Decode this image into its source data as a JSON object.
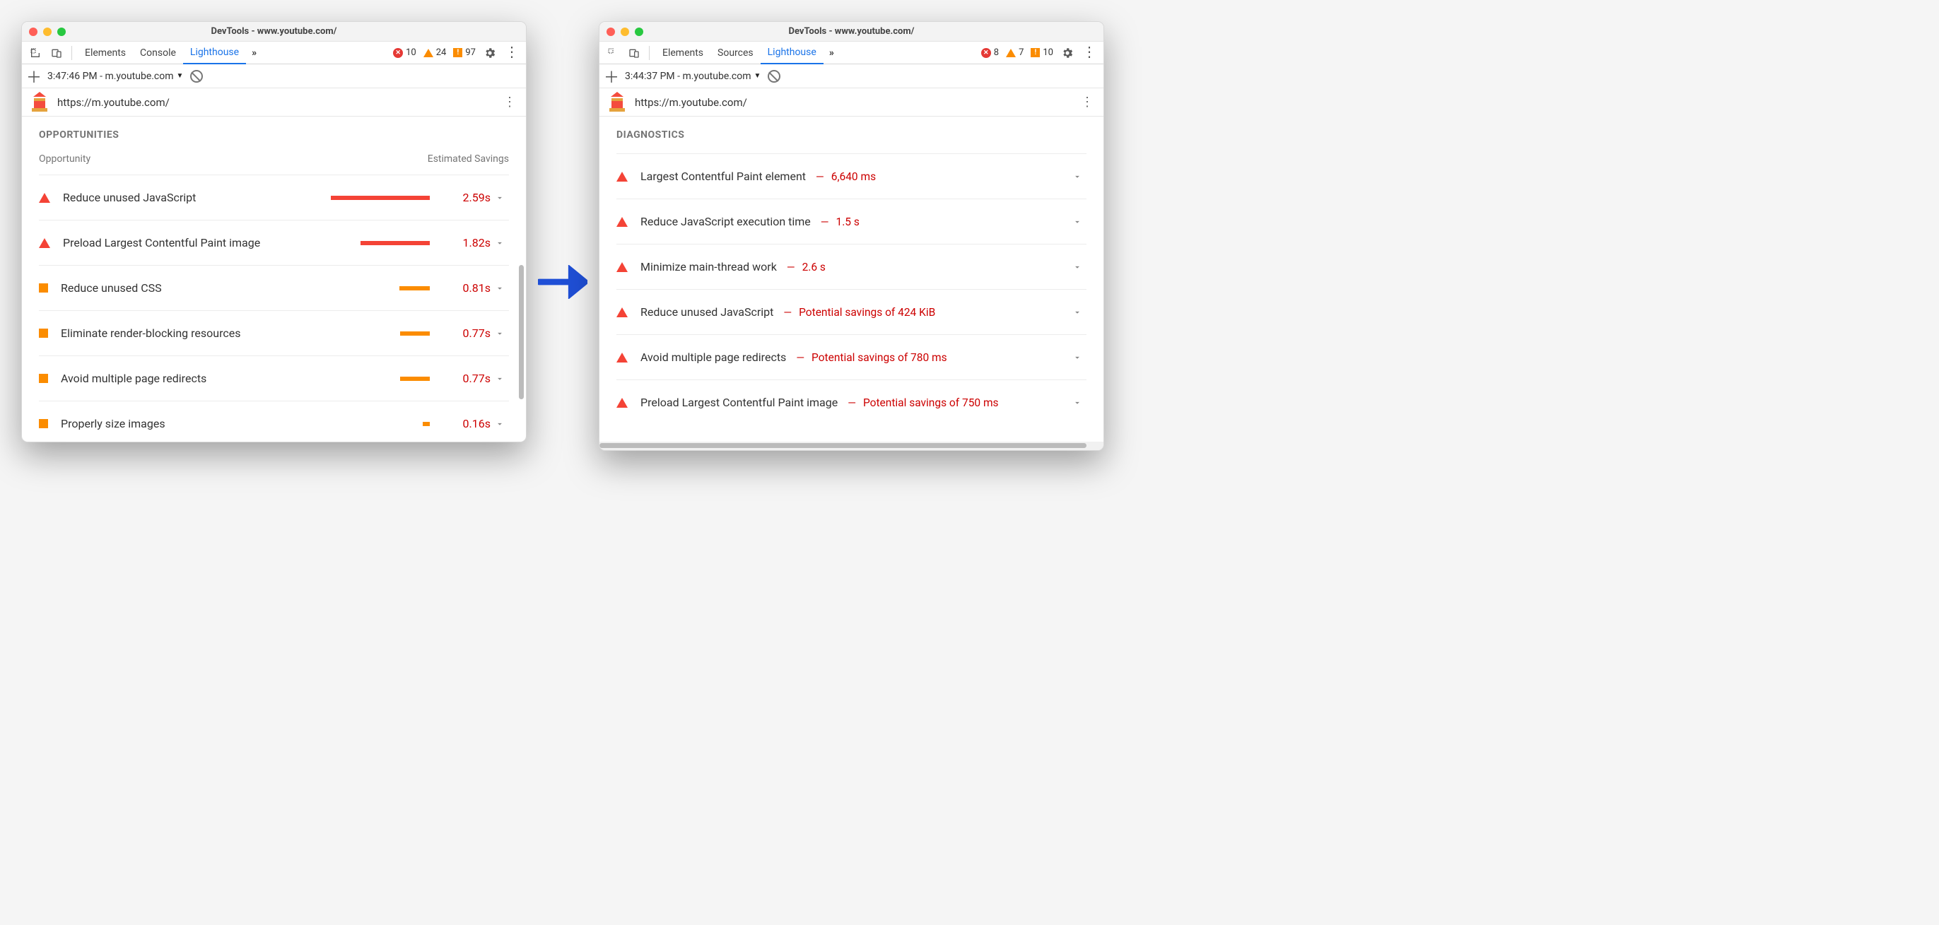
{
  "left": {
    "window_title": "DevTools - www.youtube.com/",
    "tabs": [
      "Elements",
      "Console",
      "Lighthouse"
    ],
    "active_tab_index": 2,
    "counts": {
      "errors": "10",
      "warnings": "24",
      "info": "97"
    },
    "timestamp": "3:47:46 PM - m.youtube.com",
    "url": "https://m.youtube.com/",
    "section": "OPPORTUNITIES",
    "col1": "Opportunity",
    "col2": "Estimated Savings",
    "audits": [
      {
        "sev": "tri",
        "title": "Reduce unused JavaScript",
        "bar_pct": 100,
        "bar_color": "#f44336",
        "savings": "2.59s"
      },
      {
        "sev": "tri",
        "title": "Preload Largest Contentful Paint image",
        "bar_pct": 70,
        "bar_color": "#f44336",
        "savings": "1.82s"
      },
      {
        "sev": "sq",
        "title": "Reduce unused CSS",
        "bar_pct": 31,
        "bar_color": "#fb8c00",
        "savings": "0.81s"
      },
      {
        "sev": "sq",
        "title": "Eliminate render-blocking resources",
        "bar_pct": 30,
        "bar_color": "#fb8c00",
        "savings": "0.77s"
      },
      {
        "sev": "sq",
        "title": "Avoid multiple page redirects",
        "bar_pct": 30,
        "bar_color": "#fb8c00",
        "savings": "0.77s"
      },
      {
        "sev": "sq",
        "title": "Properly size images",
        "bar_pct": 7,
        "bar_color": "#fb8c00",
        "savings": "0.16s"
      }
    ]
  },
  "right": {
    "window_title": "DevTools - www.youtube.com/",
    "tabs": [
      "Elements",
      "Sources",
      "Lighthouse"
    ],
    "active_tab_index": 2,
    "counts": {
      "errors": "8",
      "warnings": "7",
      "info": "10"
    },
    "timestamp": "3:44:37 PM - m.youtube.com",
    "url": "https://m.youtube.com/",
    "section": "DIAGNOSTICS",
    "audits": [
      {
        "sev": "tri",
        "title": "Largest Contentful Paint element",
        "metric": "6,640 ms"
      },
      {
        "sev": "tri",
        "title": "Reduce JavaScript execution time",
        "metric": "1.5 s"
      },
      {
        "sev": "tri",
        "title": "Minimize main-thread work",
        "metric": "2.6 s"
      },
      {
        "sev": "tri",
        "title": "Reduce unused JavaScript",
        "metric": "Potential savings of 424 KiB"
      },
      {
        "sev": "tri",
        "title": "Avoid multiple page redirects",
        "metric": "Potential savings of 780 ms"
      },
      {
        "sev": "tri",
        "title": "Preload Largest Contentful Paint image",
        "metric": "Potential savings of 750 ms"
      }
    ]
  }
}
